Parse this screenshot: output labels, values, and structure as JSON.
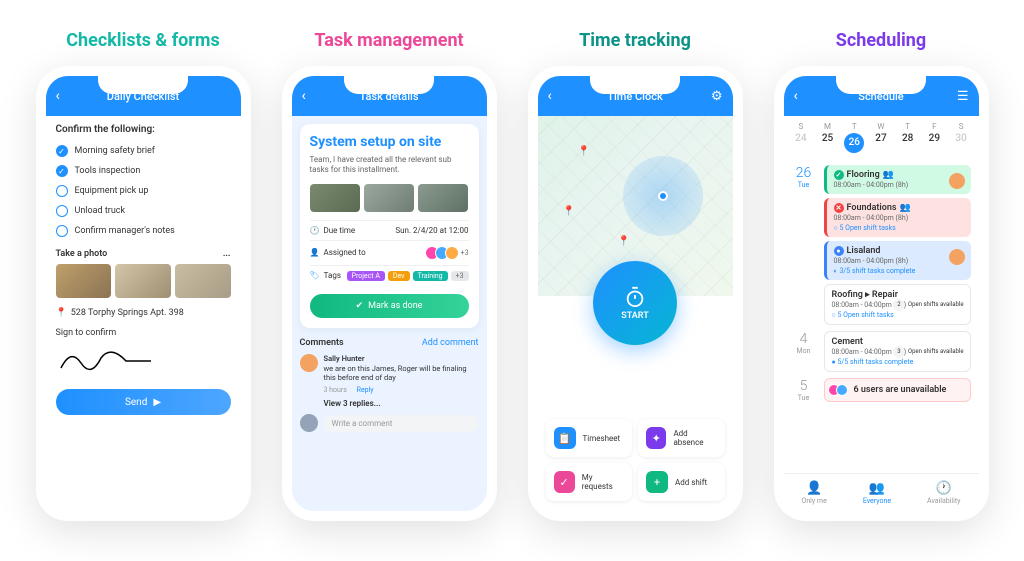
{
  "headings": {
    "p1": "Checklists & forms",
    "p2": "Task management",
    "p3": "Time tracking",
    "p4": "Scheduling"
  },
  "p1": {
    "title": "Daily Checklist",
    "confirm": "Confirm the following:",
    "items": [
      {
        "label": "Morning safety brief",
        "checked": true
      },
      {
        "label": "Tools inspection",
        "checked": true
      },
      {
        "label": "Equipment pick up",
        "checked": false
      },
      {
        "label": "Unload truck",
        "checked": false
      },
      {
        "label": "Confirm manager's notes",
        "checked": false
      }
    ],
    "photo_label": "Take a photo",
    "more": "...",
    "address": "528 Torphy Springs Apt. 398",
    "sign_label": "Sign to confirm",
    "send": "Send"
  },
  "p2": {
    "title": "Task details",
    "task_title": "System setup on site",
    "task_desc": "Team, I have created all the relevant sub tasks for this installment.",
    "due_label": "Due time",
    "due_value": "Sun. 2/4/20 at 12:00",
    "assigned_label": "Assigned to",
    "plus_count": "+3",
    "tags_label": "Tags",
    "tags": [
      "Project A",
      "Dev",
      "Training",
      "+3"
    ],
    "done": "Mark as done",
    "comments_label": "Comments",
    "add_comment": "Add comment",
    "commenter": "Sally Hunter",
    "comment_text": "we are on this James, Roger will be finaling this before end of day",
    "comment_time": "3 hours",
    "reply": "Reply",
    "view_replies": "View 3 replies...",
    "write_placeholder": "Write a comment"
  },
  "p3": {
    "title": "Time Clock",
    "start": "START",
    "cards": [
      {
        "label": "Timesheet"
      },
      {
        "label": "Add absence"
      },
      {
        "label": "My requests"
      },
      {
        "label": "Add shift"
      }
    ]
  },
  "p4": {
    "title": "Schedule",
    "weekdays": [
      {
        "d": "S",
        "n": "24",
        "dim": true
      },
      {
        "d": "M",
        "n": "25"
      },
      {
        "d": "T",
        "n": "26",
        "sel": true
      },
      {
        "d": "W",
        "n": "27"
      },
      {
        "d": "T",
        "n": "28"
      },
      {
        "d": "F",
        "n": "29"
      },
      {
        "d": "S",
        "n": "30",
        "dim": true
      }
    ],
    "days": [
      {
        "num": "26",
        "dow": "Tue",
        "color": "blue",
        "items": [
          {
            "type": "green",
            "name": "Flooring",
            "time": "08:00am - 04:00pm (8h)",
            "icon": "g",
            "avatar": true,
            "people": true
          },
          {
            "type": "red",
            "name": "Foundations",
            "time": "08:00am - 04:00pm (8h)",
            "sub": "○ 5 Open shift tasks",
            "icon": "r",
            "people": true
          },
          {
            "type": "blue",
            "name": "Lisaland",
            "time": "08:00am - 04:00pm (8h)",
            "sub": "◐ 3/5 shift tasks complete",
            "icon": "b",
            "avatar": true
          },
          {
            "type": "white",
            "name": "Roofing ▸ Repair",
            "time": "08:00am - 04:00pm (8h)",
            "sub": "○ 5 Open shift tasks",
            "badge": "2",
            "badge_text": "Open shifts available"
          }
        ]
      },
      {
        "num": "4",
        "dow": "Mon",
        "color": "gray",
        "items": [
          {
            "type": "white",
            "name": "Cement",
            "time": "08:00am - 04:00pm (8h)",
            "sub": "● 5/5 shift tasks complete",
            "badge": "3",
            "badge_text": "Open shifts available"
          }
        ]
      },
      {
        "num": "5",
        "dow": "Tue",
        "color": "gray",
        "items": [
          {
            "type": "pale",
            "name": "6 users are unavailable",
            "unavail": true
          }
        ]
      }
    ],
    "bottom": [
      {
        "label": "Only me"
      },
      {
        "label": "Everyone",
        "active": true
      },
      {
        "label": "Availability"
      }
    ]
  }
}
